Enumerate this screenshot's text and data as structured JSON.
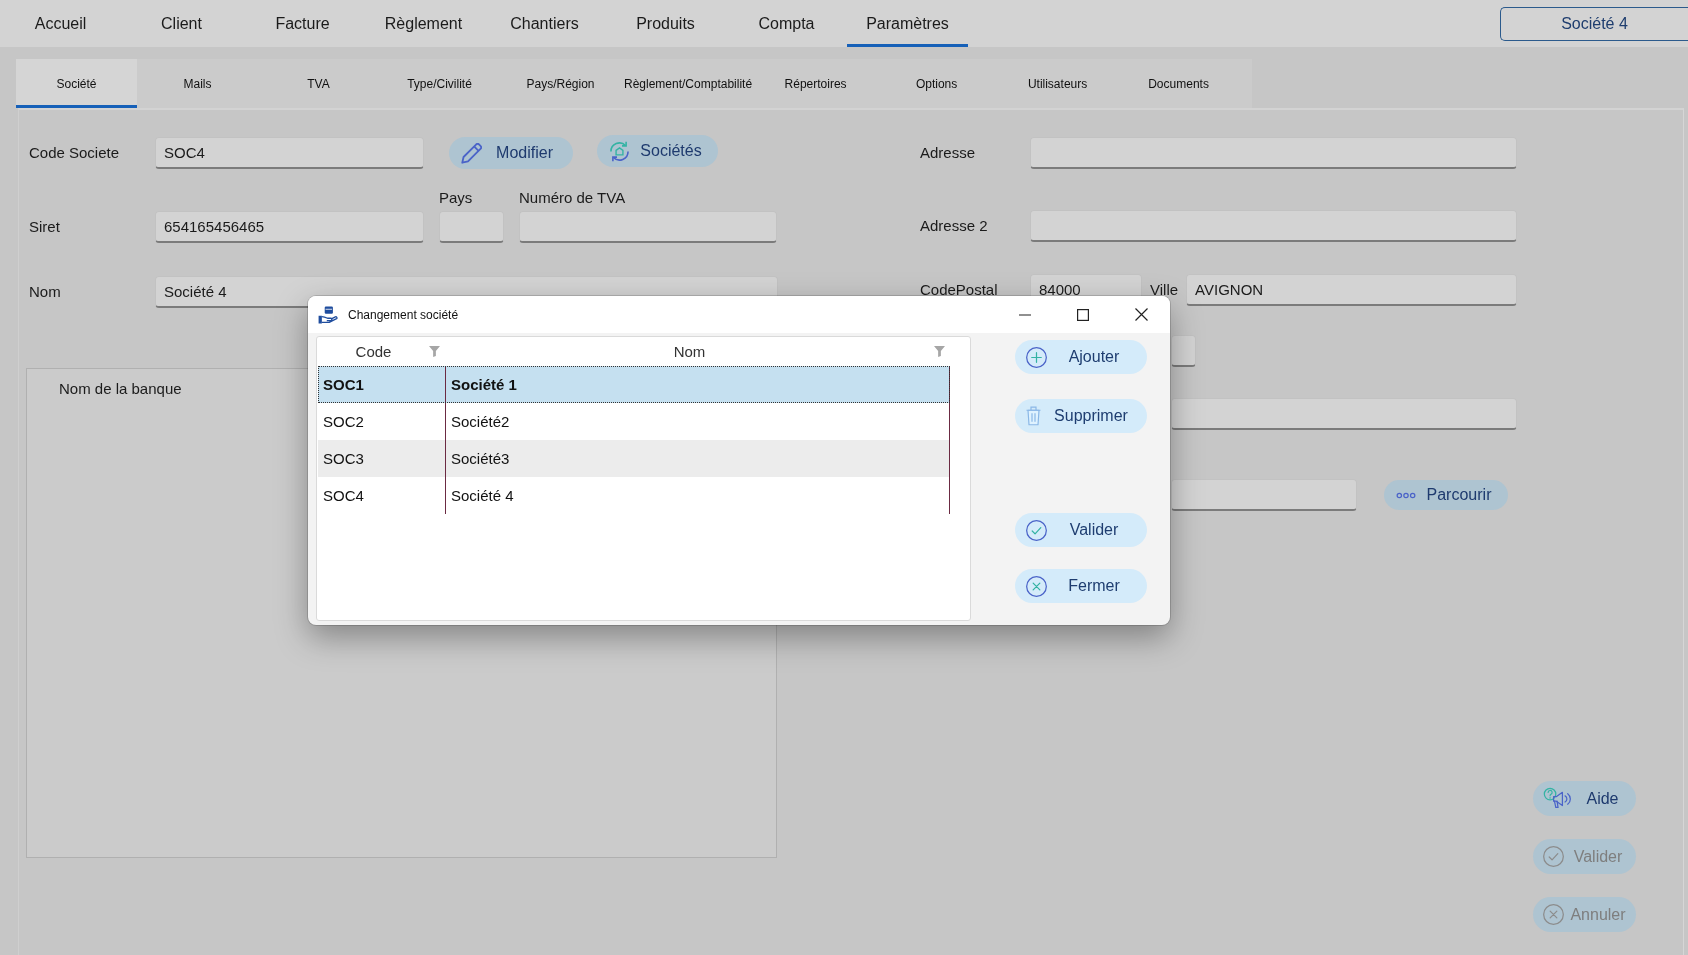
{
  "main_tabs": [
    {
      "label": "Accueil",
      "selected": false
    },
    {
      "label": "Client",
      "selected": false
    },
    {
      "label": "Facture",
      "selected": false
    },
    {
      "label": "Règlement",
      "selected": false
    },
    {
      "label": "Chantiers",
      "selected": false
    },
    {
      "label": "Produits",
      "selected": false
    },
    {
      "label": "Compta",
      "selected": false
    },
    {
      "label": "Paramètres",
      "selected": true
    }
  ],
  "company_switch": {
    "label": "Société 4"
  },
  "sub_tabs": [
    {
      "label": "Société",
      "selected": true
    },
    {
      "label": "Mails",
      "selected": false
    },
    {
      "label": "TVA",
      "selected": false
    },
    {
      "label": "Type/Civilité",
      "selected": false
    },
    {
      "label": "Pays/Région",
      "selected": false
    },
    {
      "label": "Règlement/Comptabilité",
      "selected": false
    },
    {
      "label": "Répertoires",
      "selected": false
    },
    {
      "label": "Options",
      "selected": false
    },
    {
      "label": "Utilisateurs",
      "selected": false
    },
    {
      "label": "Documents",
      "selected": false
    }
  ],
  "company_form": {
    "code": {
      "label": "Code Societe",
      "value": "SOC4"
    },
    "actions": [
      {
        "kind": "edit",
        "label": "Modifier"
      },
      {
        "kind": "switch",
        "label": "Sociétés"
      }
    ],
    "siret": {
      "label": "Siret",
      "value": "654165456465"
    },
    "country": {
      "label": "Pays"
    },
    "vat_number": {
      "label": "Numéro de TVA"
    },
    "name": {
      "label": "Nom",
      "value": "Société 4"
    },
    "bank_panel": {
      "header": "Nom de la banque"
    }
  },
  "address_form": {
    "rows": [
      {
        "kind": "field",
        "label": "Adresse"
      },
      {
        "kind": "field",
        "label": "Adresse 2"
      },
      {
        "kind": "postal_city",
        "label": "CodePostal",
        "value": "84000",
        "city_label": "Ville",
        "city_value": "AVIGNON"
      },
      {
        "kind": "short_field"
      },
      {
        "kind": "field"
      },
      {
        "kind": "browse_field",
        "button": "Parcourir"
      }
    ]
  },
  "footer_buttons": [
    {
      "kind": "help",
      "label": "Aide",
      "disabled": false
    },
    {
      "kind": "validate",
      "label": "Valider",
      "disabled": true
    },
    {
      "kind": "cancel",
      "label": "Annuler",
      "disabled": true
    }
  ],
  "dialog": {
    "title": "Changement société",
    "table": {
      "columns": [
        {
          "label": "Code"
        },
        {
          "label": "Nom"
        }
      ],
      "rows": [
        {
          "code": "SOC1",
          "name": "Société 1",
          "selected": true
        },
        {
          "code": "SOC2",
          "name": "Société2",
          "selected": false
        },
        {
          "code": "SOC3",
          "name": "Société3",
          "selected": false
        },
        {
          "code": "SOC4",
          "name": "Société 4",
          "selected": false
        }
      ]
    },
    "buttons": [
      {
        "kind": "add",
        "label": "Ajouter"
      },
      {
        "kind": "delete",
        "label": "Supprimer"
      },
      {
        "kind": "validate",
        "label": "Valider"
      },
      {
        "kind": "close",
        "label": "Fermer"
      }
    ]
  }
}
